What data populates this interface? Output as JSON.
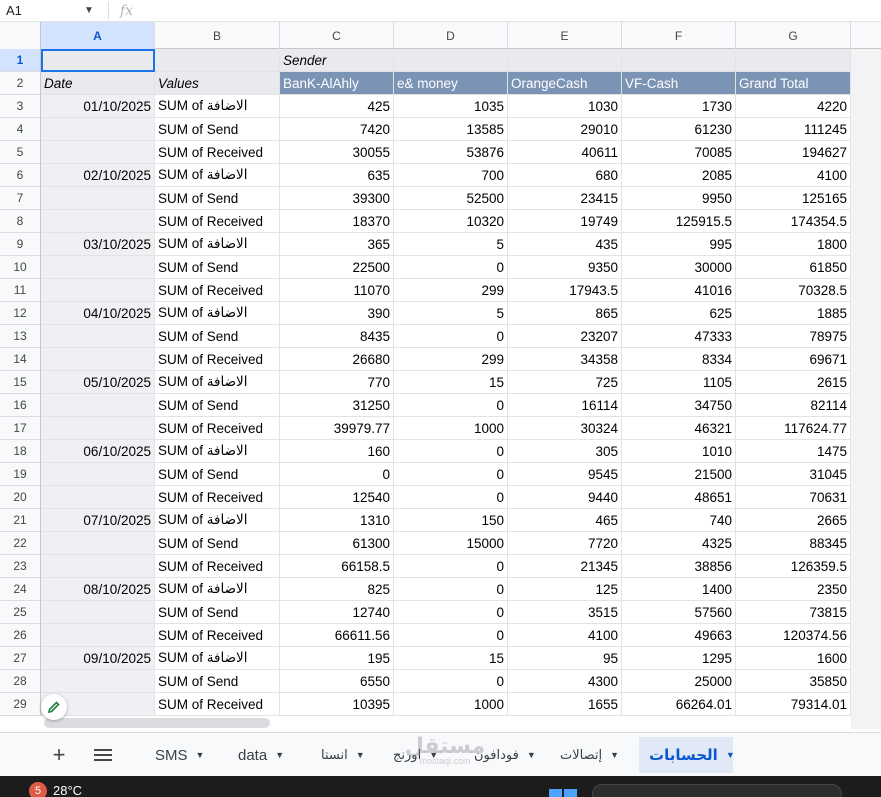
{
  "name_box": "A1",
  "formula_icon": "fx",
  "columns": [
    "A",
    "B",
    "C",
    "D",
    "E",
    "F",
    "G"
  ],
  "header_rows": {
    "row1": {
      "c": "Sender"
    },
    "row2": {
      "a": "Date",
      "b": "Values",
      "c": "BanK-AlAhly",
      "d": "e& money",
      "e": "OrangeCash",
      "f": "VF-Cash",
      "g": "Grand Total"
    }
  },
  "row_numbers": [
    "1",
    "2",
    "3",
    "4",
    "5",
    "6",
    "7",
    "8",
    "9",
    "10",
    "11",
    "12",
    "13",
    "14",
    "15",
    "16",
    "17",
    "18",
    "19",
    "20",
    "21",
    "22",
    "23",
    "24",
    "25",
    "26",
    "27",
    "28",
    "29"
  ],
  "data_rows": [
    [
      "01/10/2025",
      "SUM of الاضافة",
      "425",
      "1035",
      "1030",
      "1730",
      "4220"
    ],
    [
      "",
      "SUM of Send",
      "7420",
      "13585",
      "29010",
      "61230",
      "111245"
    ],
    [
      "",
      "SUM of Received",
      "30055",
      "53876",
      "40611",
      "70085",
      "194627"
    ],
    [
      "02/10/2025",
      "SUM of الاضافة",
      "635",
      "700",
      "680",
      "2085",
      "4100"
    ],
    [
      "",
      "SUM of Send",
      "39300",
      "52500",
      "23415",
      "9950",
      "125165"
    ],
    [
      "",
      "SUM of Received",
      "18370",
      "10320",
      "19749",
      "125915.5",
      "174354.5"
    ],
    [
      "03/10/2025",
      "SUM of الاضافة",
      "365",
      "5",
      "435",
      "995",
      "1800"
    ],
    [
      "",
      "SUM of Send",
      "22500",
      "0",
      "9350",
      "30000",
      "61850"
    ],
    [
      "",
      "SUM of Received",
      "11070",
      "299",
      "17943.5",
      "41016",
      "70328.5"
    ],
    [
      "04/10/2025",
      "SUM of الاضافة",
      "390",
      "5",
      "865",
      "625",
      "1885"
    ],
    [
      "",
      "SUM of Send",
      "8435",
      "0",
      "23207",
      "47333",
      "78975"
    ],
    [
      "",
      "SUM of Received",
      "26680",
      "299",
      "34358",
      "8334",
      "69671"
    ],
    [
      "05/10/2025",
      "SUM of الاضافة",
      "770",
      "15",
      "725",
      "1105",
      "2615"
    ],
    [
      "",
      "SUM of Send",
      "31250",
      "0",
      "16114",
      "34750",
      "82114"
    ],
    [
      "",
      "SUM of Received",
      "39979.77",
      "1000",
      "30324",
      "46321",
      "117624.77"
    ],
    [
      "06/10/2025",
      "SUM of الاضافة",
      "160",
      "0",
      "305",
      "1010",
      "1475"
    ],
    [
      "",
      "SUM of Send",
      "0",
      "0",
      "9545",
      "21500",
      "31045"
    ],
    [
      "",
      "SUM of Received",
      "12540",
      "0",
      "9440",
      "48651",
      "70631"
    ],
    [
      "07/10/2025",
      "SUM of الاضافة",
      "1310",
      "150",
      "465",
      "740",
      "2665"
    ],
    [
      "",
      "SUM of Send",
      "61300",
      "15000",
      "7720",
      "4325",
      "88345"
    ],
    [
      "",
      "SUM of Received",
      "66158.5",
      "0",
      "21345",
      "38856",
      "126359.5"
    ],
    [
      "08/10/2025",
      "SUM of الاضافة",
      "825",
      "0",
      "125",
      "1400",
      "2350"
    ],
    [
      "",
      "SUM of Send",
      "12740",
      "0",
      "3515",
      "57560",
      "73815"
    ],
    [
      "",
      "SUM of Received",
      "66611.56",
      "0",
      "4100",
      "49663",
      "120374.56"
    ],
    [
      "09/10/2025",
      "SUM of الاضافة",
      "195",
      "15",
      "95",
      "1295",
      "1600"
    ],
    [
      "",
      "SUM of Send",
      "6550",
      "0",
      "4300",
      "25000",
      "35850"
    ],
    [
      "",
      "SUM of Received",
      "10395",
      "1000",
      "1655",
      "66264.01",
      "79314.01"
    ]
  ],
  "tabs": {
    "add_icon": "plus-icon",
    "menu_icon": "all-sheets-icon",
    "sheets": [
      {
        "label": "SMS",
        "active": false
      },
      {
        "label": "data",
        "active": false
      },
      {
        "label": "انستا",
        "active": false
      },
      {
        "label": "اورنج",
        "active": false
      },
      {
        "label": "فودافون",
        "active": false
      },
      {
        "label": "إتصالات",
        "active": false
      },
      {
        "label": "الحسابات",
        "active": true
      }
    ]
  },
  "watermark": {
    "main": "مستقل",
    "sub": "mostaql.com"
  },
  "taskbar": {
    "badge": "5",
    "temperature": "28°C"
  },
  "colors": {
    "header_blue": "#7b93b5",
    "selection": "#1a73e8",
    "active_tab": "#0b57d0"
  }
}
